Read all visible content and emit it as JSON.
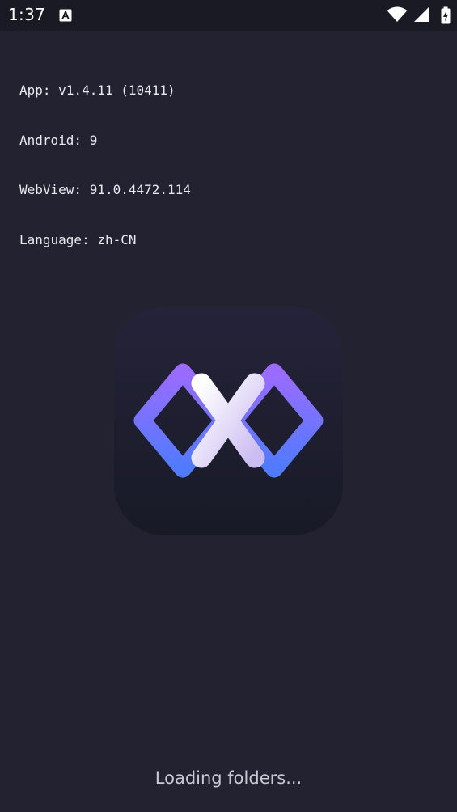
{
  "status_bar": {
    "time": "1:37",
    "left_icons": [
      "a-notification-icon"
    ],
    "right_icons": [
      "wifi-icon",
      "cellular-signal-icon",
      "battery-charging-icon"
    ]
  },
  "debug_info": {
    "app": "App: v1.4.11 (10411)",
    "android": "Android: 9",
    "webview": "WebView: 91.0.4472.114",
    "language": "Language: zh-CN"
  },
  "logo": {
    "icon": "app-logo-icon",
    "colors": {
      "tile_top": "#25233a",
      "tile_bottom": "#181a26",
      "accent_purple": "#9b6bff",
      "accent_blue": "#4f7bff",
      "x_light": "#ffffff",
      "x_lavender": "#cbbcf2"
    }
  },
  "loading": {
    "text": "Loading folders..."
  },
  "colors": {
    "background": "#222230",
    "status_bar": "#1a1a24",
    "text": "#e8e8ee"
  }
}
